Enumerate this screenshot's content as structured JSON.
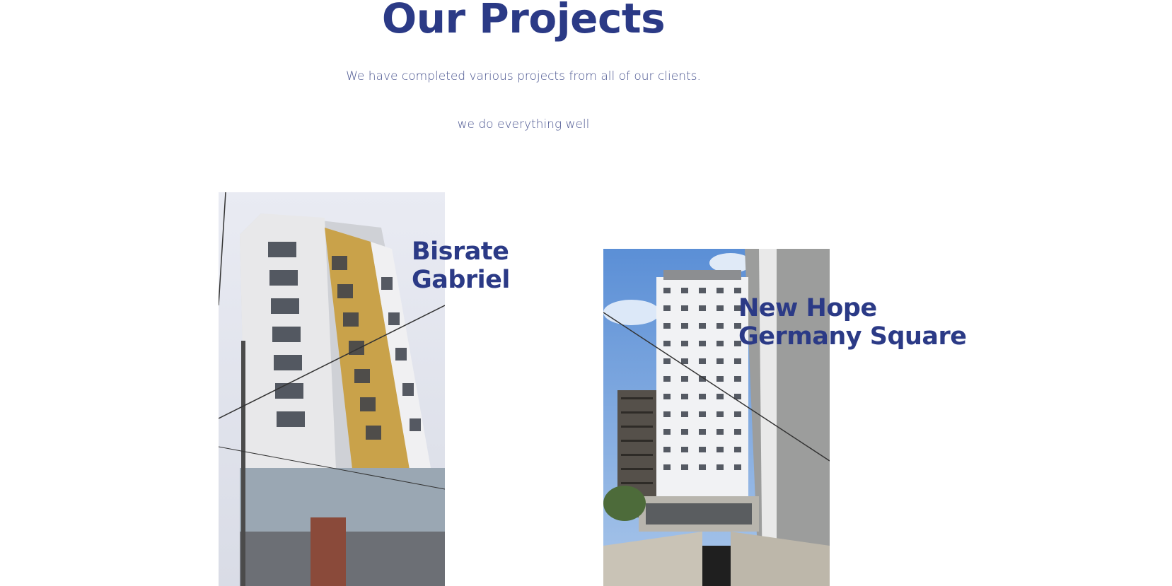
{
  "header": {
    "title": "Our Projects",
    "subtitle_line_1": "We have completed various projects from all of our clients.",
    "subtitle_line_2": "we do everything well"
  },
  "projects": [
    {
      "name_line_1": "Bisrate",
      "name_line_2": "Gabriel"
    },
    {
      "name_line_1": "New Hope",
      "name_line_2": "Germany Square"
    }
  ],
  "colors": {
    "heading": "#2b3a86",
    "subtitle": "#4a5590",
    "background": "#ffffff"
  }
}
